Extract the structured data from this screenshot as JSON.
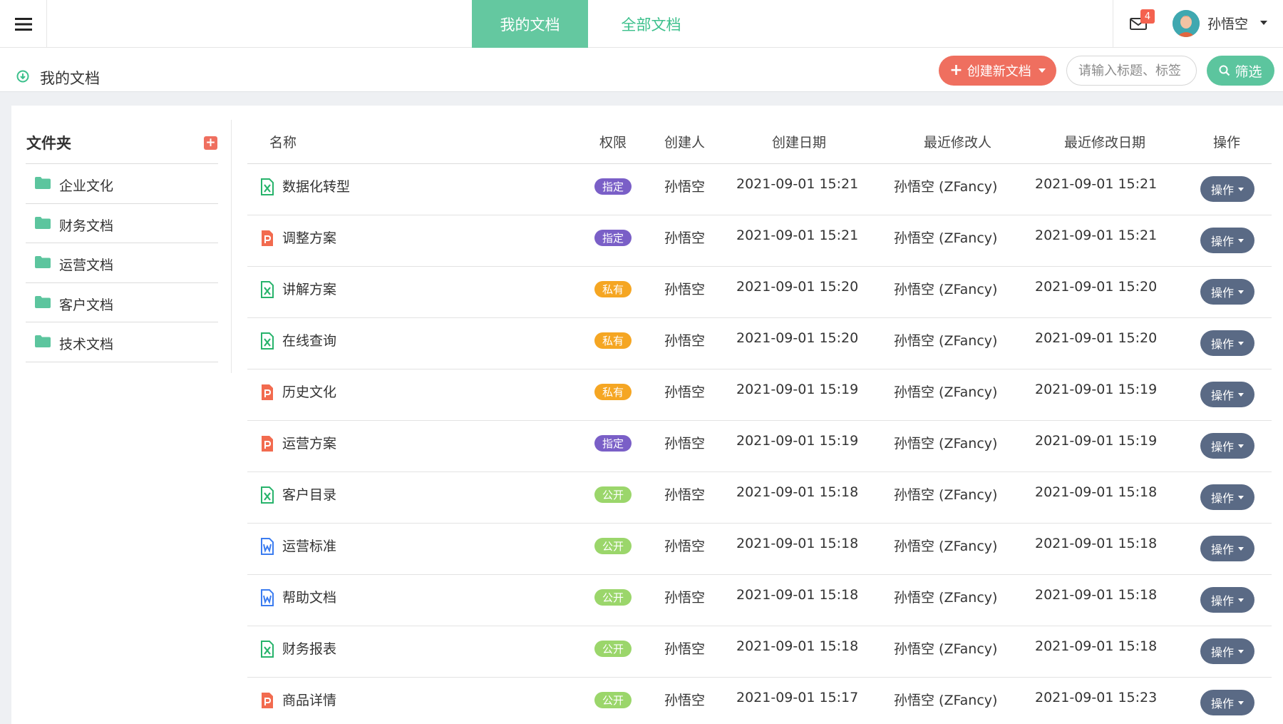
{
  "topbar": {
    "tabs": [
      {
        "label": "我的文档",
        "active": true
      },
      {
        "label": "全部文档",
        "active": false
      }
    ],
    "mail_count": "4",
    "username": "孙悟空"
  },
  "subheader": {
    "title": "我的文档",
    "create_label": "创建新文档",
    "search_placeholder": "请输入标题、标签",
    "filter_label": "筛选"
  },
  "folders": {
    "title": "文件夹",
    "items": [
      {
        "label": "企业文化"
      },
      {
        "label": "财务文档"
      },
      {
        "label": "运营文档"
      },
      {
        "label": "客户文档"
      },
      {
        "label": "技术文档"
      }
    ]
  },
  "table": {
    "headers": {
      "name": "名称",
      "permission": "权限",
      "creator": "创建人",
      "created": "创建日期",
      "modifier": "最近修改人",
      "modified": "最近修改日期",
      "action": "操作"
    },
    "action_label": "操作",
    "rows": [
      {
        "type": "excel",
        "name": "数据化转型",
        "perm": "指定",
        "perm_color": "#7a5fc7",
        "creator": "孙悟空",
        "created": "2021-09-01 15:21",
        "modifier": "孙悟空 (ZFancy)",
        "modified": "2021-09-01 15:21"
      },
      {
        "type": "ppt",
        "name": "调整方案",
        "perm": "指定",
        "perm_color": "#7a5fc7",
        "creator": "孙悟空",
        "created": "2021-09-01 15:21",
        "modifier": "孙悟空 (ZFancy)",
        "modified": "2021-09-01 15:21"
      },
      {
        "type": "excel",
        "name": "讲解方案",
        "perm": "私有",
        "perm_color": "#f5a623",
        "creator": "孙悟空",
        "created": "2021-09-01 15:20",
        "modifier": "孙悟空 (ZFancy)",
        "modified": "2021-09-01 15:20"
      },
      {
        "type": "excel",
        "name": "在线查询",
        "perm": "私有",
        "perm_color": "#f5a623",
        "creator": "孙悟空",
        "created": "2021-09-01 15:20",
        "modifier": "孙悟空 (ZFancy)",
        "modified": "2021-09-01 15:20"
      },
      {
        "type": "ppt",
        "name": "历史文化",
        "perm": "私有",
        "perm_color": "#f5a623",
        "creator": "孙悟空",
        "created": "2021-09-01 15:19",
        "modifier": "孙悟空 (ZFancy)",
        "modified": "2021-09-01 15:19"
      },
      {
        "type": "ppt",
        "name": "运营方案",
        "perm": "指定",
        "perm_color": "#7a5fc7",
        "creator": "孙悟空",
        "created": "2021-09-01 15:19",
        "modifier": "孙悟空 (ZFancy)",
        "modified": "2021-09-01 15:19"
      },
      {
        "type": "excel",
        "name": "客户目录",
        "perm": "公开",
        "perm_color": "#9bd66b",
        "creator": "孙悟空",
        "created": "2021-09-01 15:18",
        "modifier": "孙悟空 (ZFancy)",
        "modified": "2021-09-01 15:18"
      },
      {
        "type": "word",
        "name": "运营标准",
        "perm": "公开",
        "perm_color": "#9bd66b",
        "creator": "孙悟空",
        "created": "2021-09-01 15:18",
        "modifier": "孙悟空 (ZFancy)",
        "modified": "2021-09-01 15:18"
      },
      {
        "type": "word",
        "name": "帮助文档",
        "perm": "公开",
        "perm_color": "#9bd66b",
        "creator": "孙悟空",
        "created": "2021-09-01 15:18",
        "modifier": "孙悟空 (ZFancy)",
        "modified": "2021-09-01 15:18"
      },
      {
        "type": "excel",
        "name": "财务报表",
        "perm": "公开",
        "perm_color": "#9bd66b",
        "creator": "孙悟空",
        "created": "2021-09-01 15:18",
        "modifier": "孙悟空 (ZFancy)",
        "modified": "2021-09-01 15:18"
      },
      {
        "type": "ppt",
        "name": "商品详情",
        "perm": "公开",
        "perm_color": "#9bd66b",
        "creator": "孙悟空",
        "created": "2021-09-01 15:17",
        "modifier": "孙悟空 (ZFancy)",
        "modified": "2021-09-01 15:23"
      }
    ]
  },
  "colors": {
    "accent_green": "#64c8a0",
    "create_red": "#ef6f5f",
    "action_slate": "#5a6a85",
    "excel_green": "#27b36b",
    "ppt_orange": "#f26b4f",
    "word_blue": "#3b7cf0"
  },
  "icons": {
    "menu": "hamburger-icon",
    "mail": "envelope-icon",
    "sub": "download-circle-icon",
    "folder": "folder-icon",
    "add": "plus-square-icon",
    "search": "search-icon"
  }
}
